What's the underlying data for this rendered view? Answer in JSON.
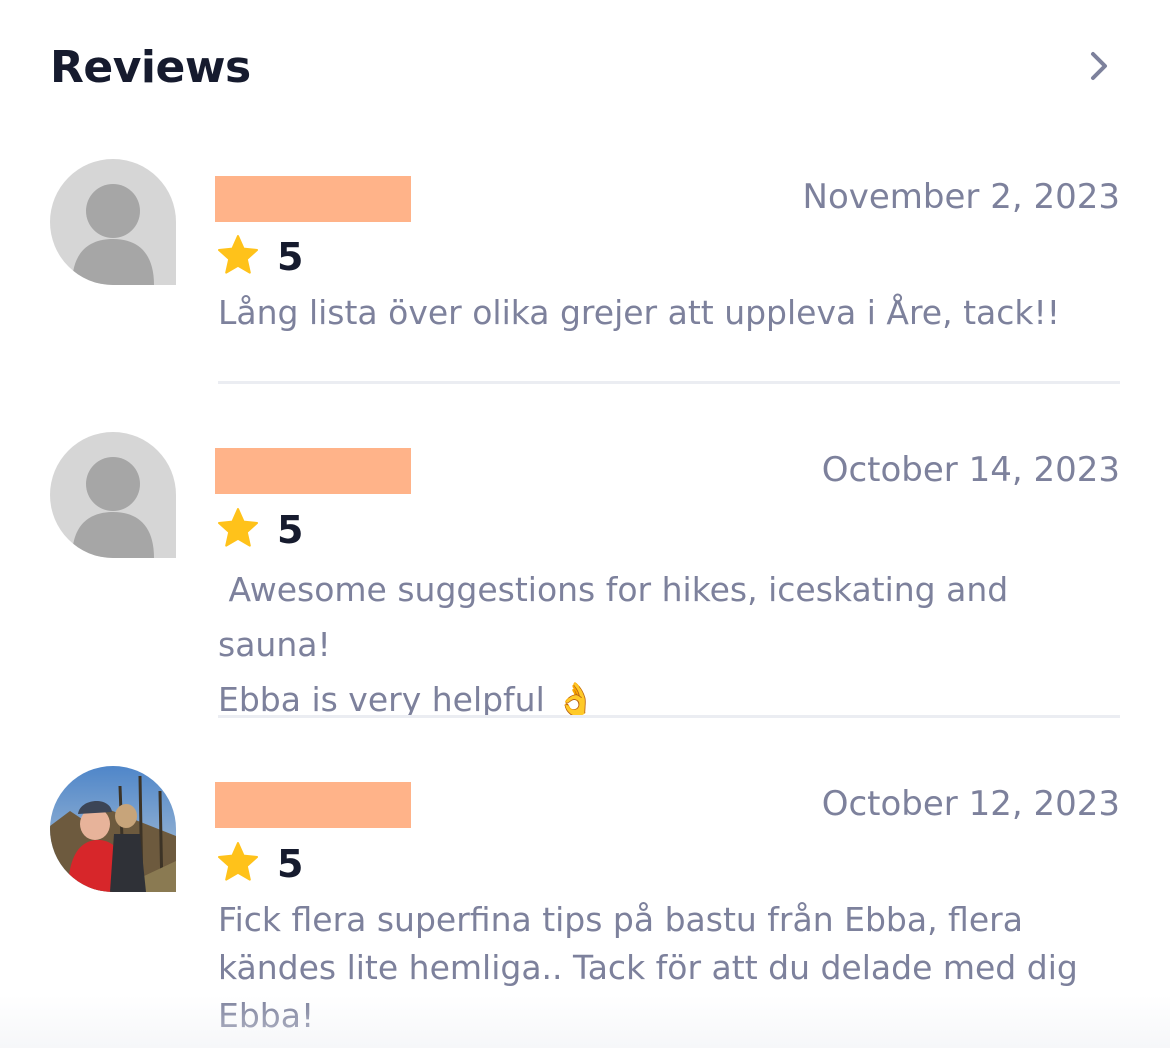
{
  "header": {
    "title": "Reviews",
    "chevron_icon": "chevron-right-icon"
  },
  "colors": {
    "title": "#161b2e",
    "muted_text": "#7d819c",
    "name_redaction": "#ffb389",
    "star": "#ffc21a",
    "divider": "#ebedf2"
  },
  "reviews": [
    {
      "avatar": "default-avatar-icon",
      "date": "November 2, 2023",
      "rating": "5",
      "text": "Lång lista över olika grejer att uppleva i Åre, tack!!"
    },
    {
      "avatar": "default-avatar-icon",
      "date": "October 14, 2023",
      "rating": "5",
      "text": " Awesome suggestions for hikes, iceskating and sauna!\nEbba is very helpful 👌"
    },
    {
      "avatar": "user-photo-avatar",
      "date": "October 12, 2023",
      "rating": "5",
      "text": "Fick flera superfina tips på bastu från Ebba, flera\nkändes lite hemliga.. Tack för att du delade med dig\nEbba!"
    }
  ]
}
